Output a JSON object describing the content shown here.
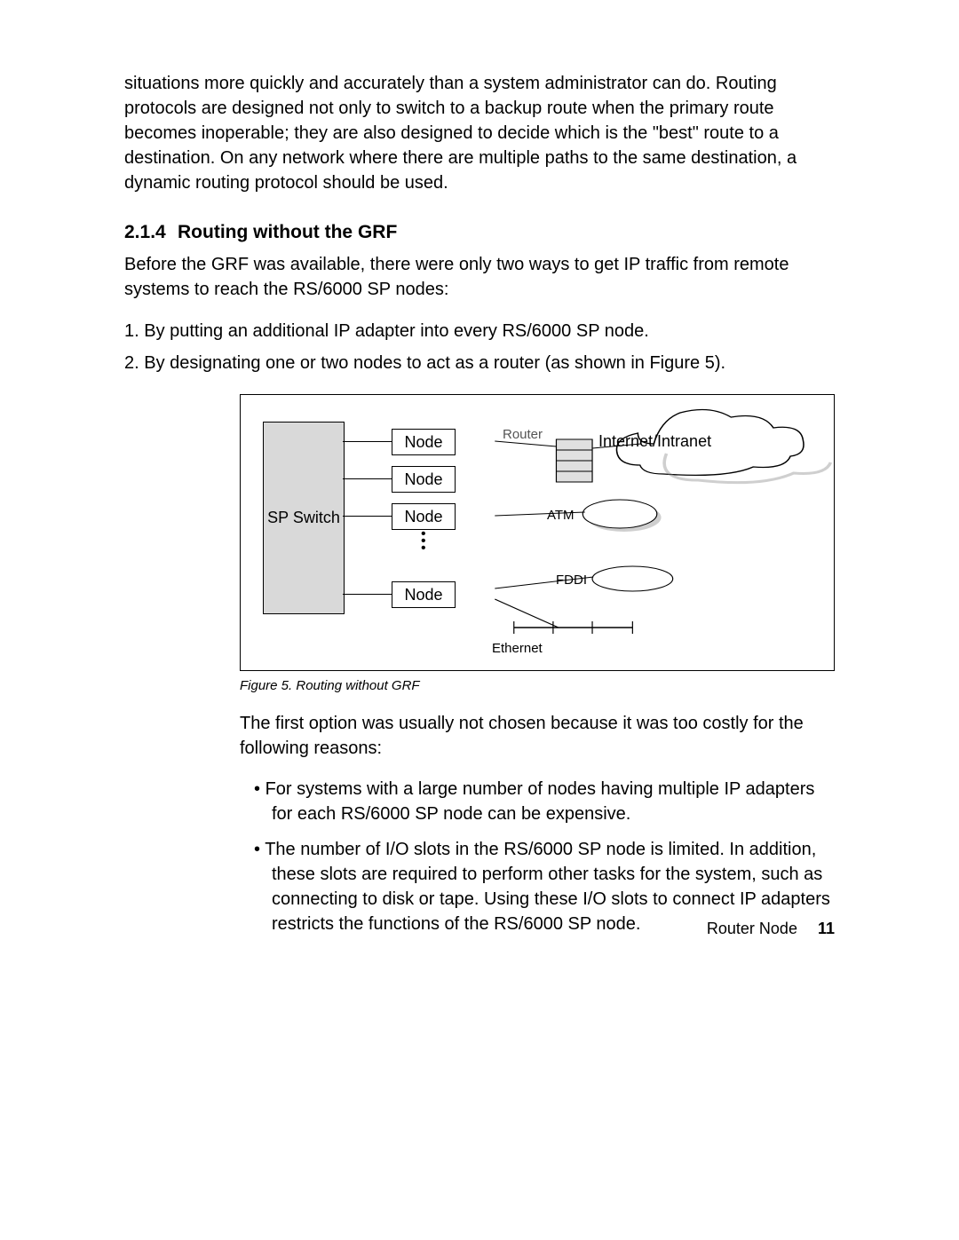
{
  "intro_paragraph": "situations more quickly and accurately than a system administrator can do. Routing protocols are designed not only to switch to a backup route when the primary route becomes inoperable; they are also designed to decide which is the \"best\" route to a destination. On any network where there are multiple paths to the same destination, a dynamic routing protocol should be used.",
  "section": {
    "number": "2.1.4",
    "title": "Routing without the GRF"
  },
  "section_intro": "Before the GRF was available, there were only two ways to get IP traffic from remote systems to reach the RS/6000 SP nodes:",
  "ordered": [
    "1. By putting an additional IP adapter into every RS/6000 SP node.",
    "2. By designating one or two nodes to act as a router (as shown in Figure 5)."
  ],
  "figure": {
    "sp_switch": "SP Switch",
    "node": "Node",
    "router": "Router",
    "atm": "ATM",
    "fddi": "FDDI",
    "ethernet": "Ethernet",
    "cloud": "Internet/Intranet",
    "caption": "Figure 5.  Routing without GRF"
  },
  "after_fig": "The first option was usually not chosen because it was too costly for the following reasons:",
  "bullets": [
    "For systems with a large number of nodes having multiple IP adapters for each RS/6000 SP node can be expensive.",
    "The number of I/O slots in the RS/6000 SP node is limited. In addition, these slots are required to perform other tasks for the system, such as connecting to disk or tape. Using these I/O slots to connect IP adapters restricts the functions of the RS/6000 SP node."
  ],
  "footer_text": "Router Node",
  "page_number": "11"
}
